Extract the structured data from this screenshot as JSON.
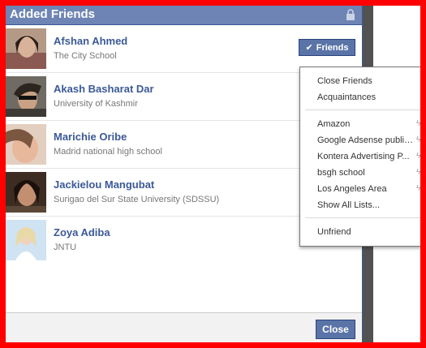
{
  "dialog": {
    "title": "Added Friends",
    "friends_button_label": "Friends",
    "close_label": "Close"
  },
  "friends": [
    {
      "name": "Afshan Ahmed",
      "subtitle": "The City School"
    },
    {
      "name": "Akash Basharat Dar",
      "subtitle": "University of Kashmir"
    },
    {
      "name": "Marichie Oribe",
      "subtitle": "Madrid national high school"
    },
    {
      "name": "Jackielou Mangubat",
      "subtitle": "Surigao del Sur State University (SDSSU)"
    },
    {
      "name": "Zoya Adiba",
      "subtitle": "JNTU"
    }
  ],
  "menu": {
    "lists_top": [
      "Close Friends",
      "Acquaintances"
    ],
    "lists": [
      "Amazon",
      "Google Adsense publis...",
      "Kontera Advertising P...",
      "bsgh school",
      "Los Angeles Area"
    ],
    "show_all": "Show All Lists...",
    "unfriend": "Unfriend"
  },
  "colors": {
    "header": "#6d84b4",
    "button": "#5b74a8",
    "name_link": "#3b5998",
    "annotation_frame": "#ff0000"
  }
}
